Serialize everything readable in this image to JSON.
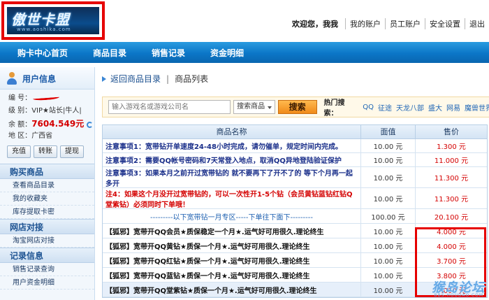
{
  "header": {
    "logo_text": "傲世卡盟",
    "logo_sub": "www.aoshika.com",
    "welcome": "欢迎您，我我",
    "links": [
      "我的账户",
      "员工账户",
      "安全设置",
      "退出"
    ]
  },
  "nav": {
    "items": [
      "购卡中心首页",
      "商品目录",
      "销售记录",
      "资金明细"
    ]
  },
  "sidebar": {
    "user_title": "用户信息",
    "id_label": "编  号：",
    "level_label": "级  别：",
    "level_value": "VIP★站长|牛人|",
    "balance_label": "余  额：",
    "balance_value": "7604.549元",
    "region_label": "地  区：",
    "region_value": "广西省",
    "buttons": [
      "充值",
      "转账",
      "提现"
    ],
    "sections": [
      {
        "title": "购买商品",
        "links": [
          "查看商品目录",
          "我的收藏夹",
          "库存提取卡密"
        ]
      },
      {
        "title": "网店对接",
        "links": [
          "淘宝网店对接"
        ]
      },
      {
        "title": "记录信息",
        "links": [
          "销售记录查询",
          "用户资金明细"
        ]
      }
    ]
  },
  "main": {
    "back_link": "返回商品目录",
    "separator": "|",
    "current": "商品列表",
    "search": {
      "placeholder": "输入游戏名或游戏公司名",
      "select_value": "搜索商品",
      "button": "搜索",
      "hot_label": "热门搜索：",
      "hot_items": [
        "QQ",
        "征途",
        "天龙八部",
        "盛大",
        "网易",
        "魔兽世界"
      ]
    },
    "table": {
      "headers": [
        "商品名称",
        "面值",
        "售价"
      ],
      "rows": [
        {
          "name": "注意事项1：宽带钻开单速度24-48小时完成，请勿催单，规定时间内完成。",
          "face": "10.00 元",
          "price": "1.300 元"
        },
        {
          "name": "注意事项2：需要QQ帐号密码和7天常登入地点，取消QQ异地登陆验证保护",
          "face": "10.00 元",
          "price": "11.000 元"
        },
        {
          "name": "注意事项3：如果本月之前开过宽带钻的  就不要再下了开不了的  等下个月再一起多开",
          "face": "10.00 元",
          "price": "11.300 元"
        },
        {
          "name": "注4：如果这个月没开过宽带钻的，可以一次性开1-5个钻（会员黄钻蓝钻红钻Q堂紫钻）必须同时下单哦！",
          "face": "10.00 元",
          "price": "11.300 元"
        },
        {
          "name": "---------以下宽带钻一月专区-----下单往下面下---------",
          "face": "100.00 元",
          "price": "20.100 元"
        },
        {
          "name": "【狐邪】宽带开QQ会员★质保稳定一个月★.运气好可用很久.理论终生",
          "face": "10.00 元",
          "price": "4.000 元"
        },
        {
          "name": "【狐邪】宽带开QQ黄钻★质保一个月★.运气好可用很久.理论终生",
          "face": "10.00 元",
          "price": "4.000 元"
        },
        {
          "name": "【狐邪】宽带开QQ红钻★质保一个月★.运气好可用很久.理论终生",
          "face": "10.00 元",
          "price": "3.700 元"
        },
        {
          "name": "【狐邪】宽带开QQ蓝钻★质保一个月★.运气好可用很久.理论终生",
          "face": "10.00 元",
          "price": "3.800 元"
        },
        {
          "name": "【狐邪】宽带开QQ堂紫钻★质保一个月★.运气好可用很久.理论终生",
          "face": "10.00 元",
          "price": "4.000 元"
        }
      ]
    }
  },
  "watermark": {
    "main": "猴岛论坛",
    "sub": "BBS.HOUDAO.COM"
  }
}
